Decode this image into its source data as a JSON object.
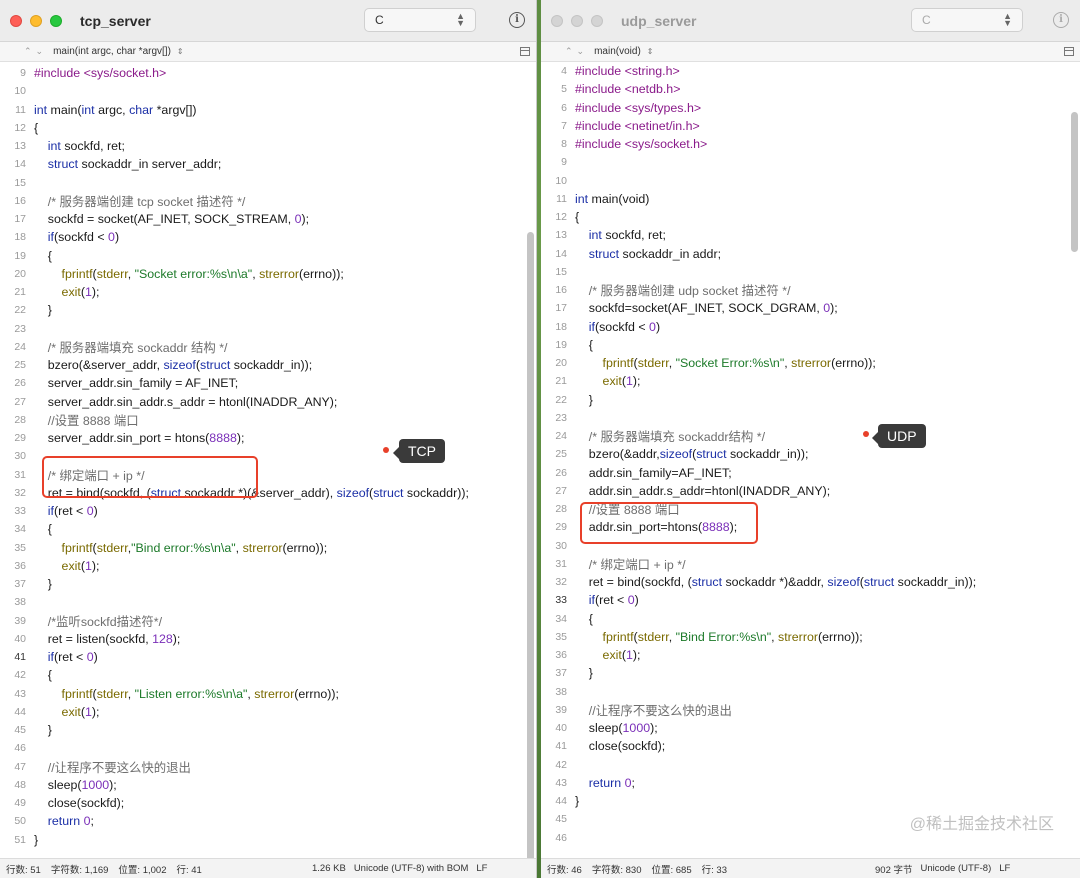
{
  "left_window": {
    "title": "tcp_server",
    "language": "C",
    "function": "main(int argc, char *argv[])",
    "annotation_label": "TCP",
    "status": {
      "lines": "行数:  51",
      "chars": "字符数:  1,169",
      "position": "位置:  1,002",
      "row": "行:  41",
      "size": "1.26 KB",
      "encoding": "Unicode (UTF-8) with BOM",
      "line_ending": "LF"
    },
    "current_line": 41,
    "lines": [
      {
        "n": "9",
        "t": "#include <sys/socket.h>"
      },
      {
        "n": "10",
        "t": ""
      },
      {
        "n": "11",
        "t": "int main(int argc, char *argv[])"
      },
      {
        "n": "12",
        "t": "{"
      },
      {
        "n": "13",
        "t": "    int sockfd, ret;"
      },
      {
        "n": "14",
        "t": "    struct sockaddr_in server_addr;"
      },
      {
        "n": "15",
        "t": ""
      },
      {
        "n": "16",
        "t": "    /* 服务器端创建 tcp socket 描述符 */"
      },
      {
        "n": "17",
        "t": "    sockfd = socket(AF_INET, SOCK_STREAM, 0);"
      },
      {
        "n": "18",
        "t": "    if(sockfd < 0)"
      },
      {
        "n": "19",
        "t": "    {"
      },
      {
        "n": "20",
        "t": "        fprintf(stderr, \"Socket error:%s\\n\\a\", strerror(errno));"
      },
      {
        "n": "21",
        "t": "        exit(1);"
      },
      {
        "n": "22",
        "t": "    }"
      },
      {
        "n": "23",
        "t": ""
      },
      {
        "n": "24",
        "t": "    /* 服务器端填充 sockaddr 结构 */"
      },
      {
        "n": "25",
        "t": "    bzero(&server_addr, sizeof(struct sockaddr_in));"
      },
      {
        "n": "26",
        "t": "    server_addr.sin_family = AF_INET;"
      },
      {
        "n": "27",
        "t": "    server_addr.sin_addr.s_addr = htonl(INADDR_ANY);"
      },
      {
        "n": "28",
        "t": "    //设置 8888 端口"
      },
      {
        "n": "29",
        "t": "    server_addr.sin_port = htons(8888);"
      },
      {
        "n": "30",
        "t": ""
      },
      {
        "n": "31",
        "t": "    /* 绑定端口 + ip */"
      },
      {
        "n": "32",
        "t": "    ret = bind(sockfd, (struct sockaddr *)(&server_addr), sizeof(struct sockaddr));"
      },
      {
        "n": "33",
        "t": "    if(ret < 0)"
      },
      {
        "n": "34",
        "t": "    {"
      },
      {
        "n": "35",
        "t": "        fprintf(stderr,\"Bind error:%s\\n\\a\", strerror(errno));"
      },
      {
        "n": "36",
        "t": "        exit(1);"
      },
      {
        "n": "37",
        "t": "    }"
      },
      {
        "n": "38",
        "t": ""
      },
      {
        "n": "39",
        "t": "    /*监听sockfd描述符*/"
      },
      {
        "n": "40",
        "t": "    ret = listen(sockfd, 128);"
      },
      {
        "n": "41",
        "t": "    if(ret < 0)"
      },
      {
        "n": "42",
        "t": "    {"
      },
      {
        "n": "43",
        "t": "        fprintf(stderr, \"Listen error:%s\\n\\a\", strerror(errno));"
      },
      {
        "n": "44",
        "t": "        exit(1);"
      },
      {
        "n": "45",
        "t": "    }"
      },
      {
        "n": "46",
        "t": ""
      },
      {
        "n": "47",
        "t": "    //让程序不要这么快的退出"
      },
      {
        "n": "48",
        "t": "    sleep(1000);"
      },
      {
        "n": "49",
        "t": "    close(sockfd);"
      },
      {
        "n": "50",
        "t": "    return 0;"
      },
      {
        "n": "51",
        "t": "}"
      }
    ]
  },
  "right_window": {
    "title": "udp_server",
    "language": "C",
    "function": "main(void)",
    "annotation_label": "UDP",
    "status": {
      "lines": "行数:  46",
      "chars": "字符数:  830",
      "position": "位置:  685",
      "row": "行:  33",
      "size": "902 字节",
      "encoding": "Unicode (UTF-8)",
      "line_ending": "LF"
    },
    "current_line": 33,
    "lines": [
      {
        "n": "4",
        "t": "#include <string.h>"
      },
      {
        "n": "5",
        "t": "#include <netdb.h>"
      },
      {
        "n": "6",
        "t": "#include <sys/types.h>"
      },
      {
        "n": "7",
        "t": "#include <netinet/in.h>"
      },
      {
        "n": "8",
        "t": "#include <sys/socket.h>"
      },
      {
        "n": "9",
        "t": ""
      },
      {
        "n": "10",
        "t": ""
      },
      {
        "n": "11",
        "t": "int main(void)"
      },
      {
        "n": "12",
        "t": "{"
      },
      {
        "n": "13",
        "t": "    int sockfd, ret;"
      },
      {
        "n": "14",
        "t": "    struct sockaddr_in addr;"
      },
      {
        "n": "15",
        "t": ""
      },
      {
        "n": "16",
        "t": "    /* 服务器端创建 udp socket 描述符 */"
      },
      {
        "n": "17",
        "t": "    sockfd=socket(AF_INET, SOCK_DGRAM, 0);"
      },
      {
        "n": "18",
        "t": "    if(sockfd < 0)"
      },
      {
        "n": "19",
        "t": "    {"
      },
      {
        "n": "20",
        "t": "        fprintf(stderr, \"Socket Error:%s\\n\", strerror(errno));"
      },
      {
        "n": "21",
        "t": "        exit(1);"
      },
      {
        "n": "22",
        "t": "    }"
      },
      {
        "n": "23",
        "t": ""
      },
      {
        "n": "24",
        "t": "    /* 服务器端填充 sockaddr结构 */"
      },
      {
        "n": "25",
        "t": "    bzero(&addr,sizeof(struct sockaddr_in));"
      },
      {
        "n": "26",
        "t": "    addr.sin_family=AF_INET;"
      },
      {
        "n": "27",
        "t": "    addr.sin_addr.s_addr=htonl(INADDR_ANY);"
      },
      {
        "n": "28",
        "t": "    //设置 8888 端口"
      },
      {
        "n": "29",
        "t": "    addr.sin_port=htons(8888);"
      },
      {
        "n": "30",
        "t": ""
      },
      {
        "n": "31",
        "t": "    /* 绑定端口 + ip */"
      },
      {
        "n": "32",
        "t": "    ret = bind(sockfd, (struct sockaddr *)&addr, sizeof(struct sockaddr_in));"
      },
      {
        "n": "33",
        "t": "    if(ret < 0)"
      },
      {
        "n": "34",
        "t": "    {"
      },
      {
        "n": "35",
        "t": "        fprintf(stderr, \"Bind Error:%s\\n\", strerror(errno));"
      },
      {
        "n": "36",
        "t": "        exit(1);"
      },
      {
        "n": "37",
        "t": "    }"
      },
      {
        "n": "38",
        "t": ""
      },
      {
        "n": "39",
        "t": "    //让程序不要这么快的退出"
      },
      {
        "n": "40",
        "t": "    sleep(1000);"
      },
      {
        "n": "41",
        "t": "    close(sockfd);"
      },
      {
        "n": "42",
        "t": ""
      },
      {
        "n": "43",
        "t": "    return 0;"
      },
      {
        "n": "44",
        "t": "}"
      },
      {
        "n": "45",
        "t": ""
      },
      {
        "n": "46",
        "t": ""
      }
    ]
  },
  "watermark": "@稀土掘金技术社区",
  "colors": {
    "annotation_red": "#e8402a",
    "label_bg": "#3a3a3a",
    "keyword": "#1b2fa6",
    "preprocessor": "#8a1a8a",
    "string": "#1d7a2a",
    "number": "#7a2fb8",
    "comment": "#6e6e6e"
  }
}
